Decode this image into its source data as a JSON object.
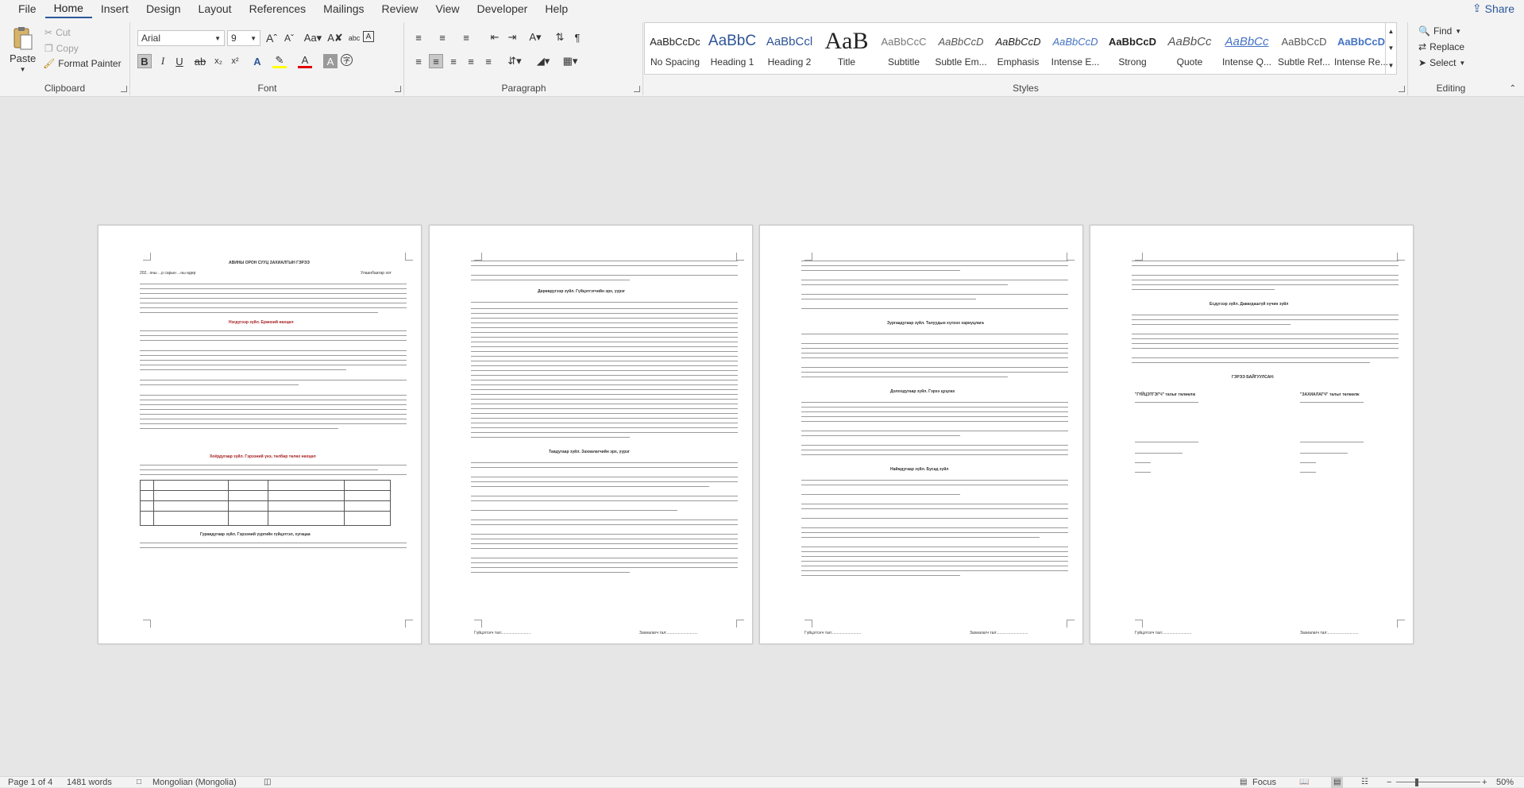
{
  "tabs": [
    "File",
    "Home",
    "Insert",
    "Design",
    "Layout",
    "References",
    "Mailings",
    "Review",
    "View",
    "Developer",
    "Help"
  ],
  "active_tab": "Home",
  "share_label": "Share",
  "clipboard": {
    "paste": "Paste",
    "cut": "Cut",
    "copy": "Copy",
    "format_painter": "Format Painter",
    "label": "Clipboard"
  },
  "font": {
    "name": "Arial",
    "size": "9",
    "label": "Font"
  },
  "paragraph": {
    "label": "Paragraph"
  },
  "styles": {
    "label": "Styles",
    "items": [
      {
        "sample": "AaBbCcDc",
        "name": "No Spacing"
      },
      {
        "sample": "AaBbC",
        "name": "Heading 1"
      },
      {
        "sample": "AaBbCcl",
        "name": "Heading 2"
      },
      {
        "sample": "AaB",
        "name": "Title"
      },
      {
        "sample": "AaBbCcC",
        "name": "Subtitle"
      },
      {
        "sample": "AaBbCcD",
        "name": "Subtle Em..."
      },
      {
        "sample": "AaBbCcD",
        "name": "Emphasis"
      },
      {
        "sample": "AaBbCcD",
        "name": "Intense E..."
      },
      {
        "sample": "AaBbCcD",
        "name": "Strong"
      },
      {
        "sample": "AaBbCc",
        "name": "Quote"
      },
      {
        "sample": "AaBbCc",
        "name": "Intense Q..."
      },
      {
        "sample": "AaBbCcD",
        "name": "Subtle Ref..."
      },
      {
        "sample": "AaBbCcD",
        "name": "Intense Re..."
      }
    ]
  },
  "editing": {
    "find": "Find",
    "replace": "Replace",
    "select": "Select",
    "label": "Editing"
  },
  "document": {
    "page1_title": "АВИНЫ ОРОН СУУЦ ЗАХИАЛГЫН ГЭРЭЭ",
    "page1_place": "Улаанбаатар хот",
    "page1_date": "202.. оны ...р сарын ...ны өдөр",
    "page1_section1": "Нэгдүгээр зүйл. Ерөнхий нөхцөл",
    "page1_section2": "Хоёрдугаар зүйл. Гэрээний үнэ, төлбөр төлөх нөхцөл",
    "page1_section3": "Гуравдугаар зүйл. Гэрээний үүргийн гүйцэтгэл, хугацаа",
    "page2_section4": "Дөрөвдүгээр зүйл. Гүйцэтгэгчийн эрх, үүрэг",
    "page2_section5": "Тавдугаар зүйл. Захиалагчийн эрх, үүрэг",
    "page3_section6": "Зургаадугаар зүйл. Талуудын хүлээх хариуцлага",
    "page3_section7": "Долоодугаар зүйл. Гэрээ цуцлах",
    "page3_section8": "Наймдугаар зүйл. Бусад зүйл",
    "page4_section9": "Есдүгээр зүйл. Давагдашгүй хүчин зүйл",
    "page4_sign": "ГЭРЭЭ БАЙГУУЛСАН:",
    "page4_party1": "\"ГҮЙЦЭТГЭГЧ\" талыг төлөөлж",
    "page4_party2": "\"ЗАХИАЛАГЧ\" талыг төлөөлж",
    "footer_left": "Гүйцэтгэгч тал:..........................",
    "footer_right": "Захиалагч тал:............................"
  },
  "status": {
    "page": "Page 1 of 4",
    "words": "1481 words",
    "language": "Mongolian (Mongolia)",
    "focus": "Focus",
    "zoom": "50%"
  }
}
